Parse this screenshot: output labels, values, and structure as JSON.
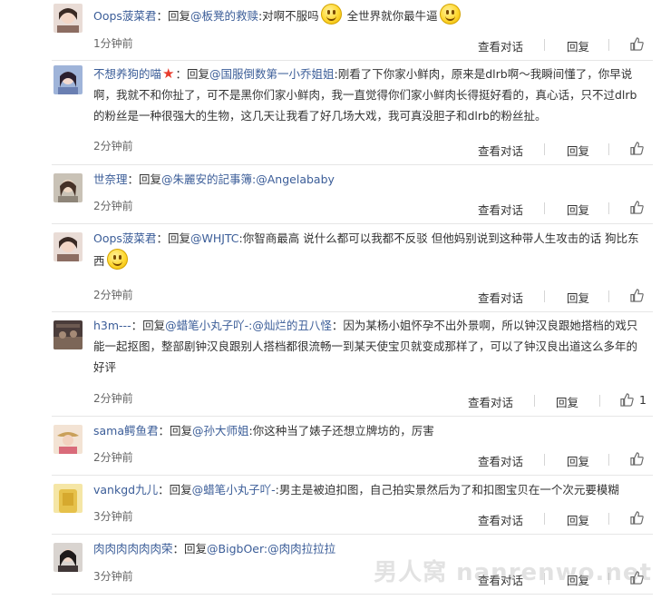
{
  "actions": {
    "view": "查看对话",
    "reply": "回复"
  },
  "comments": [
    {
      "user": "Oops菠菜君",
      "reply_prefix": "：回复",
      "mention": "@板凳的救赎",
      "text_a": ":对啊不服吗",
      "text_b": "全世界就你最牛逼",
      "time": "1分钟前",
      "likes": ""
    },
    {
      "user": "不想养狗的喵",
      "reply_prefix": "：回复",
      "mention": "@国服倒数第一小乔姐姐",
      "text_a": ":刚看了下你家小鲜肉，原来是dlrb啊～我瞬间懂了，你早说啊，我就不和你扯了，可不是黑你们家小鲜肉，我一直觉得你们家小鲜肉长得挺好看的，真心话，只不过dlrb的粉丝是一种很强大的生物，这几天让我看了好几场大戏，我可真没胆子和dlrb的粉丝扯。",
      "time": "2分钟前",
      "likes": ""
    },
    {
      "user": "世奈理",
      "reply_prefix": "：回复",
      "mention": "@朱麗安的記事簿",
      "text_a": ":@Angelababy",
      "time": "2分钟前",
      "likes": ""
    },
    {
      "user": "Oops菠菜君",
      "reply_prefix": "：回复",
      "mention": "@WHJTC",
      "text_a": ":你智商最高 说什么都可以我都不反驳 但他妈别说到这种带人生攻击的话 狗比东西",
      "time": "2分钟前",
      "likes": ""
    },
    {
      "user": "h3m---",
      "reply_prefix": "：回复",
      "mention": "@蜡笔小丸子吖-:@灿烂的丑八怪",
      "text_a": "：因为某杨小姐怀孕不出外景啊，所以钟汉良跟她搭档的戏只能一起抠图，整部剧钟汉良跟别人搭档都很流畅一到某天使宝贝就变成那样了，可以了钟汉良出道这么多年的好评",
      "time": "2分钟前",
      "likes": "1"
    },
    {
      "user": "sama鳄鱼君",
      "reply_prefix": "：回复",
      "mention": "@孙大师姐",
      "text_a": ":你这种当了婊子还想立牌坊的，厉害",
      "time": "2分钟前",
      "likes": ""
    },
    {
      "user": "vankgd九儿",
      "reply_prefix": "：回复",
      "mention": "@蜡笔小丸子吖-",
      "text_a": ":男主是被迫扣图，自己拍实景然后为了和扣图宝贝在一个次元要模糊",
      "time": "3分钟前",
      "likes": ""
    },
    {
      "user": "肉肉肉肉肉肉荣",
      "reply_prefix": "：回复",
      "mention": "@BigbOer",
      "text_a": ":@肉肉拉拉拉",
      "time": "3分钟前",
      "likes": ""
    }
  ],
  "watermark": "男人窝 nanrenwo.net",
  "colors": {
    "link": "#3b5d98",
    "text": "#333333",
    "star": "#e83b2d"
  }
}
